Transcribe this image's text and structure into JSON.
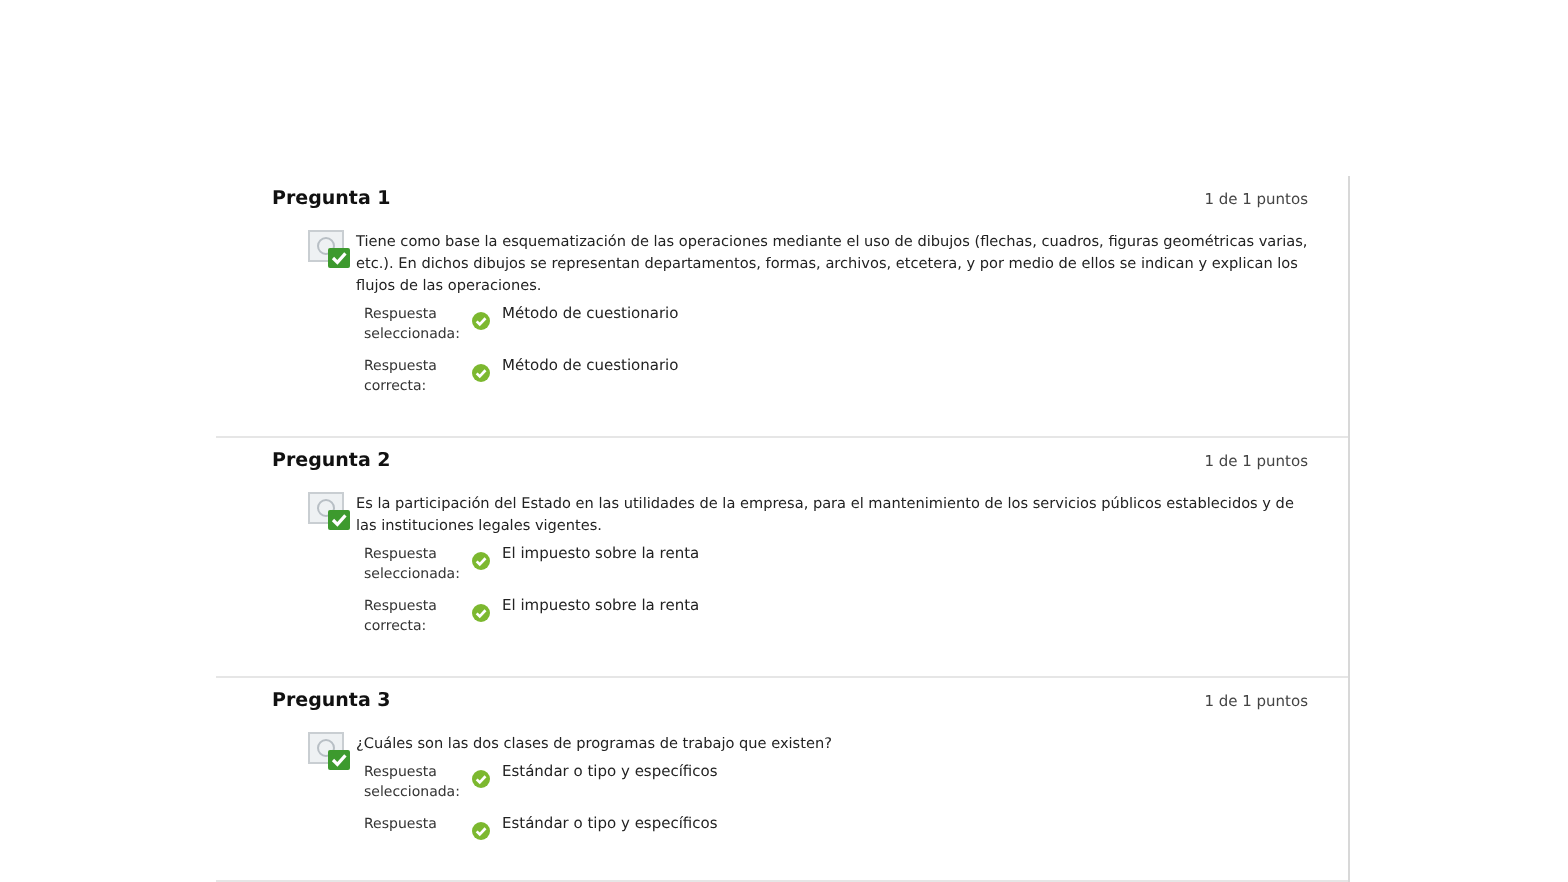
{
  "questions": [
    {
      "title": "Pregunta 1",
      "score": "1 de 1 puntos",
      "correct": true,
      "text": "Tiene como base la esquematización de las operaciones mediante el uso de dibujos (flechas, cuadros, figuras geométricas varias, etc.). En dichos dibujos se representan departamentos, formas, archivos, etcetera, y por medio de ellos se indican y explican los flujos de las operaciones.",
      "answers": [
        {
          "label": "Respuesta seleccionada:",
          "value": "Método de cuestionario",
          "correct": true
        },
        {
          "label": "Respuesta correcta:",
          "value": "Método de cuestionario",
          "correct": true
        }
      ]
    },
    {
      "title": "Pregunta 2",
      "score": "1 de 1 puntos",
      "correct": true,
      "text": "Es la participación del Estado en las utilidades de la empresa, para el mantenimiento de los servicios públicos establecidos y de las instituciones legales vigentes.",
      "answers": [
        {
          "label": "Respuesta seleccionada:",
          "value": "El impuesto sobre la renta",
          "correct": true
        },
        {
          "label": "Respuesta correcta:",
          "value": "El impuesto sobre la renta",
          "correct": true
        }
      ]
    },
    {
      "title": "Pregunta 3",
      "score": "1 de 1 puntos",
      "correct": true,
      "text": "¿Cuáles son las dos clases de programas de trabajo que existen?",
      "answers": [
        {
          "label": "Respuesta seleccionada:",
          "value": "Estándar o tipo y específicos",
          "correct": true
        },
        {
          "label": "Respuesta",
          "value": "Estándar o tipo y específicos",
          "correct": true
        }
      ]
    }
  ]
}
